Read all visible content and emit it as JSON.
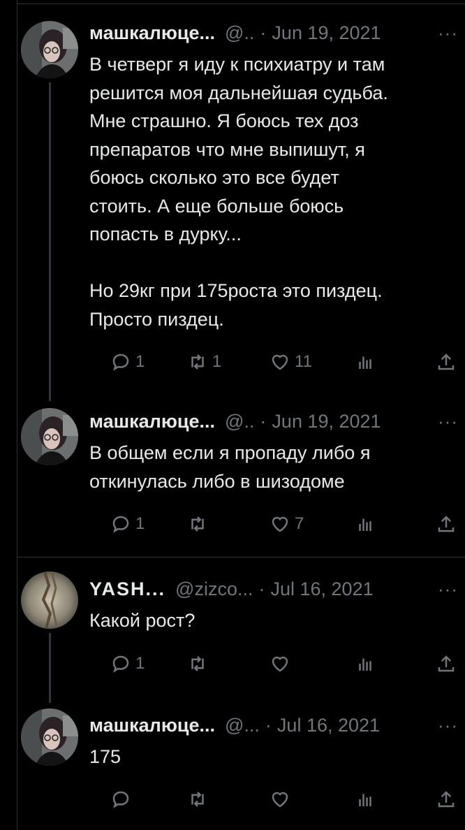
{
  "colors": {
    "background": "#000000",
    "text": "#e7e9ea",
    "muted": "#71767b",
    "border": "#2f3336"
  },
  "tweets": [
    {
      "name": "машкалюце...",
      "handle": "@..",
      "date": "Jun 19, 2021",
      "text": "В четверг я иду к психиатру и там\nрешится моя дальнейшая судьба.\nМне страшно. Я боюсь тех доз\nпрепаратов что мне выпишут, я\nбоюсь сколько это все будет\nстоить. А еще больше боюсь\nпопасть в дурку...\n\nНо 29кг при 175роста это пиздец.\nПросто пиздец.",
      "replies": "1",
      "retweets": "1",
      "likes": "11"
    },
    {
      "name": "машкалюце...",
      "handle": "@..",
      "date": "Jun 19, 2021",
      "text": "В общем если я пропаду либо я\nоткинулась либо в шизодоме",
      "replies": "1",
      "retweets": "",
      "likes": "7"
    },
    {
      "name": "YASH...",
      "handle": "@zizco...",
      "date": "Jul 16, 2021",
      "text": "Какой рост?",
      "replies": "1",
      "retweets": "",
      "likes": ""
    },
    {
      "name": "машкалюце...",
      "handle": "@...",
      "date": "Jul 16, 2021",
      "text": "175",
      "replies": "",
      "retweets": "",
      "likes": ""
    }
  ],
  "icons": {
    "more": "more-icon",
    "reply": "reply-icon",
    "retweet": "retweet-icon",
    "like": "heart-icon",
    "views": "views-icon",
    "share": "share-icon"
  },
  "more_glyph": "···",
  "separator": "·"
}
